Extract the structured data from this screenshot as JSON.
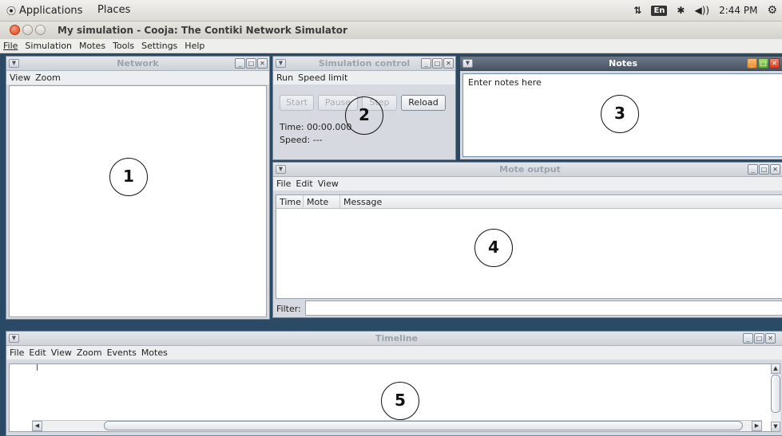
{
  "top_panel": {
    "applications": "Applications",
    "places": "Places",
    "keyboard_layout": "En",
    "clock": "2:44 PM"
  },
  "window": {
    "title": "My simulation - Cooja: The Contiki Network Simulator"
  },
  "menubar": [
    "File",
    "Simulation",
    "Motes",
    "Tools",
    "Settings",
    "Help"
  ],
  "network": {
    "title": "Network",
    "menu": [
      "View",
      "Zoom"
    ]
  },
  "sim_control": {
    "title": "Simulation control",
    "menu": [
      "Run",
      "Speed limit"
    ],
    "buttons": {
      "start": "Start",
      "pause": "Pause",
      "step": "Step",
      "reload": "Reload"
    },
    "time": "Time: 00:00.000",
    "speed": "Speed: ---"
  },
  "notes": {
    "title": "Notes",
    "text": "Enter notes here"
  },
  "mote_output": {
    "title": "Mote output",
    "menu": [
      "File",
      "Edit",
      "View"
    ],
    "columns": [
      "Time",
      "Mote",
      "Message"
    ],
    "filter_label": "Filter:"
  },
  "timeline": {
    "title": "Timeline",
    "menu": [
      "File",
      "Edit",
      "View",
      "Zoom",
      "Events",
      "Motes"
    ]
  },
  "markers": [
    "1",
    "2",
    "3",
    "4",
    "5"
  ],
  "colors": {
    "desktop": "#2b4a66",
    "frame_bg": "#d6d9df",
    "notes_title": "#4a5564"
  }
}
